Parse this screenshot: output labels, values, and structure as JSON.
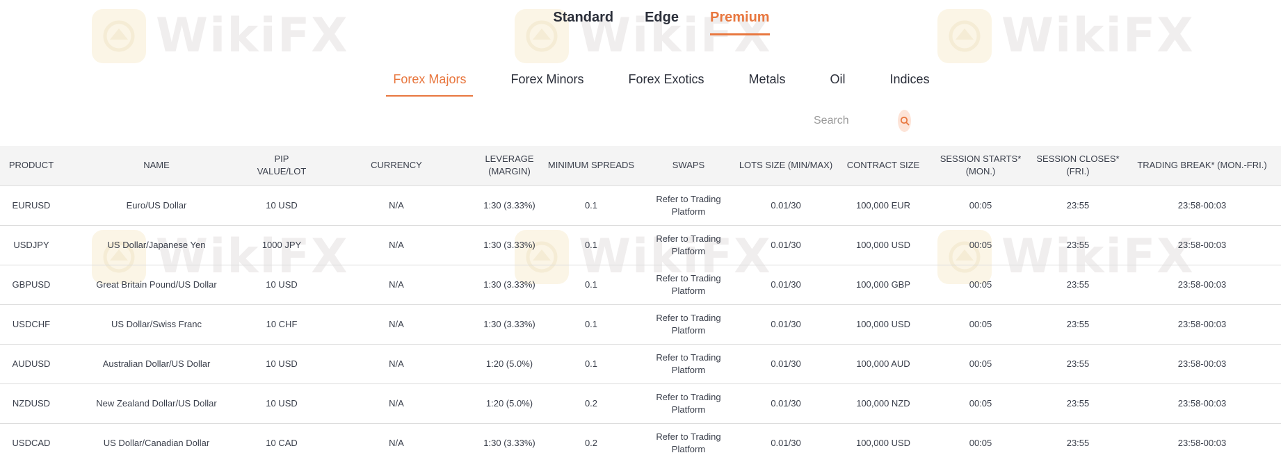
{
  "account_tabs": [
    {
      "label": "Standard",
      "active": false
    },
    {
      "label": "Edge",
      "active": false
    },
    {
      "label": "Premium",
      "active": true
    }
  ],
  "category_tabs": [
    {
      "label": "Forex Majors",
      "active": true
    },
    {
      "label": "Forex Minors",
      "active": false
    },
    {
      "label": "Forex Exotics",
      "active": false
    },
    {
      "label": "Metals",
      "active": false
    },
    {
      "label": "Oil",
      "active": false
    },
    {
      "label": "Indices",
      "active": false
    }
  ],
  "search": {
    "placeholder": "Search",
    "icon": "search-icon"
  },
  "watermark": {
    "text": "WikiFX"
  },
  "colors": {
    "accent": "#e8773f",
    "header_bg": "#f4f4f4",
    "row_border": "#dcdcdc"
  },
  "table": {
    "headers": [
      "PRODUCT",
      "NAME",
      "PIP VALUE/LOT",
      "CURRENCY",
      "LEVERAGE (MARGIN)",
      "MINIMUM SPREADS",
      "SWAPS",
      "LOTS SIZE (MIN/MAX)",
      "CONTRACT SIZE",
      "SESSION STARTS* (MON.)",
      "SESSION CLOSES* (FRI.)",
      "TRADING BREAK* (MON.-FRI.)"
    ],
    "rows": [
      [
        "EURUSD",
        "Euro/US Dollar",
        "10 USD",
        "N/A",
        "1:30 (3.33%)",
        "0.1",
        "Refer to Trading Platform",
        "0.01/30",
        "100,000 EUR",
        "00:05",
        "23:55",
        "23:58-00:03"
      ],
      [
        "USDJPY",
        "US Dollar/Japanese Yen",
        "1000 JPY",
        "N/A",
        "1:30 (3.33%)",
        "0.1",
        "Refer to Trading Platform",
        "0.01/30",
        "100,000 USD",
        "00:05",
        "23:55",
        "23:58-00:03"
      ],
      [
        "GBPUSD",
        "Great Britain Pound/US Dollar",
        "10 USD",
        "N/A",
        "1:30 (3.33%)",
        "0.1",
        "Refer to Trading Platform",
        "0.01/30",
        "100,000 GBP",
        "00:05",
        "23:55",
        "23:58-00:03"
      ],
      [
        "USDCHF",
        "US Dollar/Swiss Franc",
        "10 CHF",
        "N/A",
        "1:30 (3.33%)",
        "0.1",
        "Refer to Trading Platform",
        "0.01/30",
        "100,000 USD",
        "00:05",
        "23:55",
        "23:58-00:03"
      ],
      [
        "AUDUSD",
        "Australian Dollar/US Dollar",
        "10 USD",
        "N/A",
        "1:20 (5.0%)",
        "0.1",
        "Refer to Trading Platform",
        "0.01/30",
        "100,000 AUD",
        "00:05",
        "23:55",
        "23:58-00:03"
      ],
      [
        "NZDUSD",
        "New Zealand Dollar/US Dollar",
        "10 USD",
        "N/A",
        "1:20 (5.0%)",
        "0.2",
        "Refer to Trading Platform",
        "0.01/30",
        "100,000 NZD",
        "00:05",
        "23:55",
        "23:58-00:03"
      ],
      [
        "USDCAD",
        "US Dollar/Canadian Dollar",
        "10 CAD",
        "N/A",
        "1:30 (3.33%)",
        "0.2",
        "Refer to Trading Platform",
        "0.01/30",
        "100,000 USD",
        "00:05",
        "23:55",
        "23:58-00:03"
      ]
    ]
  }
}
